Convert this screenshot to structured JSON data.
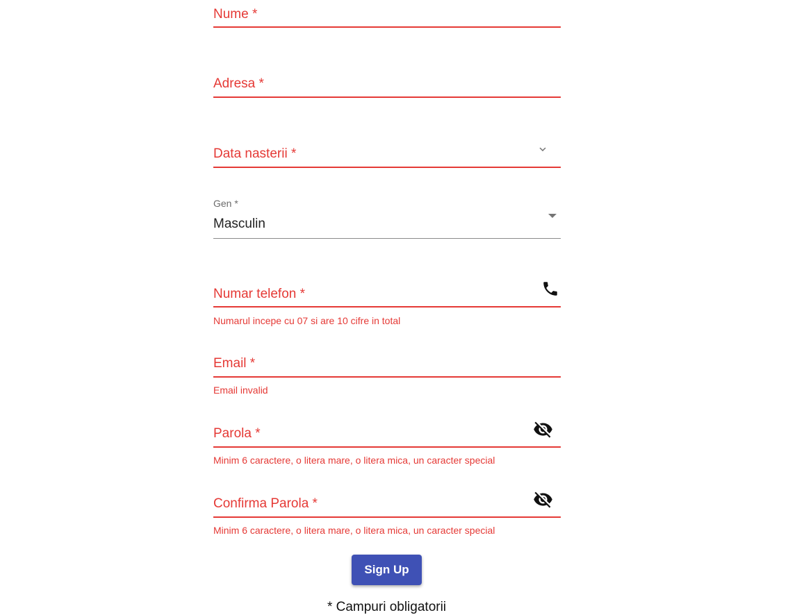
{
  "form": {
    "nume": {
      "label": "Nume *"
    },
    "adresa": {
      "label": "Adresa *"
    },
    "data_nasterii": {
      "label": "Data nasterii *"
    },
    "gen": {
      "label": "Gen *",
      "value": "Masculin"
    },
    "telefon": {
      "label": "Numar telefon *",
      "helper": "Numarul incepe cu 07 si are 10 cifre in total"
    },
    "email": {
      "label": "Email *",
      "helper": "Email invalid"
    },
    "parola": {
      "label": "Parola *",
      "helper": "Minim 6 caractere, o litera mare, o litera mica, un caracter special"
    },
    "confirma_parola": {
      "label": "Confirma Parola *",
      "helper": "Minim 6 caractere, o litera mare, o litera mica, un caracter special"
    },
    "submit_label": "Sign Up",
    "footnote": "* Campuri obligatorii"
  },
  "icons": {
    "date": "chevron-down-icon",
    "gen": "dropdown-arrow-icon",
    "telefon": "phone-icon",
    "parola": "visibility-off-icon",
    "confirma_parola": "visibility-off-icon"
  },
  "colors": {
    "error": "#e53935",
    "primary": "#3f51b5",
    "text": "#212121",
    "label_muted": "#6b6b6b"
  }
}
